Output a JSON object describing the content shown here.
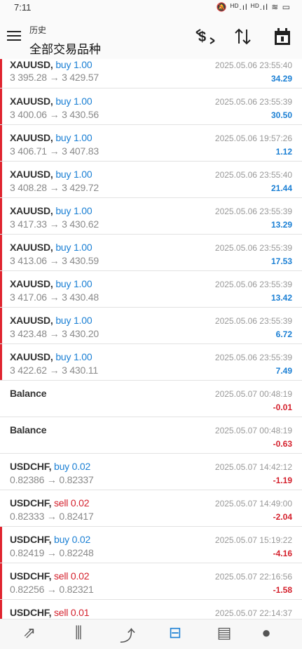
{
  "status_bar": {
    "time": "7:11",
    "left_icons": "■ ···",
    "right_icons": "🔕 ᴴᴰ.ıl ᴴᴰ.ıl ≋ ▭"
  },
  "toolbar": {
    "subtitle": "历史",
    "title": "全部交易品种",
    "icons": [
      "dollar-swap-icon",
      "sort-icon",
      "calendar-icon"
    ]
  },
  "trades": [
    {
      "symbol": "XAUUSD,",
      "side": "buy 1.00",
      "side_type": "buy",
      "prices": "3 395.28 → 3 429.57",
      "time": "2025.05.06 23:55:40",
      "profit": "34.29",
      "profit_sign": "pos",
      "bar": true
    },
    {
      "symbol": "XAUUSD,",
      "side": "buy 1.00",
      "side_type": "buy",
      "prices": "3 400.06 → 3 430.56",
      "time": "2025.05.06 23:55:39",
      "profit": "30.50",
      "profit_sign": "pos",
      "bar": true
    },
    {
      "symbol": "XAUUSD,",
      "side": "buy 1.00",
      "side_type": "buy",
      "prices": "3 406.71 → 3 407.83",
      "time": "2025.05.06 19:57:26",
      "profit": "1.12",
      "profit_sign": "pos",
      "bar": true
    },
    {
      "symbol": "XAUUSD,",
      "side": "buy 1.00",
      "side_type": "buy",
      "prices": "3 408.28 → 3 429.72",
      "time": "2025.05.06 23:55:40",
      "profit": "21.44",
      "profit_sign": "pos",
      "bar": true
    },
    {
      "symbol": "XAUUSD,",
      "side": "buy 1.00",
      "side_type": "buy",
      "prices": "3 417.33 → 3 430.62",
      "time": "2025.05.06 23:55:39",
      "profit": "13.29",
      "profit_sign": "pos",
      "bar": true
    },
    {
      "symbol": "XAUUSD,",
      "side": "buy 1.00",
      "side_type": "buy",
      "prices": "3 413.06 → 3 430.59",
      "time": "2025.05.06 23:55:39",
      "profit": "17.53",
      "profit_sign": "pos",
      "bar": true
    },
    {
      "symbol": "XAUUSD,",
      "side": "buy 1.00",
      "side_type": "buy",
      "prices": "3 417.06 → 3 430.48",
      "time": "2025.05.06 23:55:39",
      "profit": "13.42",
      "profit_sign": "pos",
      "bar": true
    },
    {
      "symbol": "XAUUSD,",
      "side": "buy 1.00",
      "side_type": "buy",
      "prices": "3 423.48 → 3 430.20",
      "time": "2025.05.06 23:55:39",
      "profit": "6.72",
      "profit_sign": "pos",
      "bar": true
    },
    {
      "symbol": "XAUUSD,",
      "side": "buy 1.00",
      "side_type": "buy",
      "prices": "3 422.62 → 3 430.11",
      "time": "2025.05.06 23:55:39",
      "profit": "7.49",
      "profit_sign": "pos",
      "bar": true
    },
    {
      "symbol": "Balance",
      "side": "",
      "side_type": "",
      "prices": "",
      "time": "2025.05.07 00:48:19",
      "profit": "-0.01",
      "profit_sign": "neg",
      "bar": false
    },
    {
      "symbol": "Balance",
      "side": "",
      "side_type": "",
      "prices": "",
      "time": "2025.05.07 00:48:19",
      "profit": "-0.63",
      "profit_sign": "neg",
      "bar": false
    },
    {
      "symbol": "USDCHF,",
      "side": "buy 0.02",
      "side_type": "buy",
      "prices": "0.82386 → 0.82337",
      "time": "2025.05.07 14:42:12",
      "profit": "-1.19",
      "profit_sign": "neg",
      "bar": false
    },
    {
      "symbol": "USDCHF,",
      "side": "sell 0.02",
      "side_type": "sell",
      "prices": "0.82333 → 0.82417",
      "time": "2025.05.07 14:49:00",
      "profit": "-2.04",
      "profit_sign": "neg",
      "bar": false
    },
    {
      "symbol": "USDCHF,",
      "side": "buy 0.02",
      "side_type": "buy",
      "prices": "0.82419 → 0.82248",
      "time": "2025.05.07 15:19:22",
      "profit": "-4.16",
      "profit_sign": "neg",
      "bar": true
    },
    {
      "symbol": "USDCHF,",
      "side": "sell 0.02",
      "side_type": "sell",
      "prices": "0.82256 → 0.82321",
      "time": "2025.05.07 22:16:56",
      "profit": "-1.58",
      "profit_sign": "neg",
      "bar": true
    },
    {
      "symbol": "USDCHF,",
      "side": "sell 0.01",
      "side_type": "sell",
      "prices": "",
      "time": "2025.05.07 22:14:37",
      "profit": "",
      "profit_sign": "neg",
      "bar": true
    }
  ],
  "bottom_nav": [
    {
      "name": "nav-quotes-icon",
      "glyph": "⇗",
      "active": false
    },
    {
      "name": "nav-chart-icon",
      "glyph": "⫼",
      "active": false
    },
    {
      "name": "nav-trade-icon",
      "glyph": "⤴",
      "active": false
    },
    {
      "name": "nav-history-icon",
      "glyph": "⊟",
      "active": true
    },
    {
      "name": "nav-news-icon",
      "glyph": "▤",
      "active": false
    },
    {
      "name": "nav-chat-icon",
      "glyph": "●",
      "active": false
    }
  ],
  "colors": {
    "buy": "#1a7fd4",
    "sell": "#d4202c",
    "accent": "#1a7fd4"
  }
}
